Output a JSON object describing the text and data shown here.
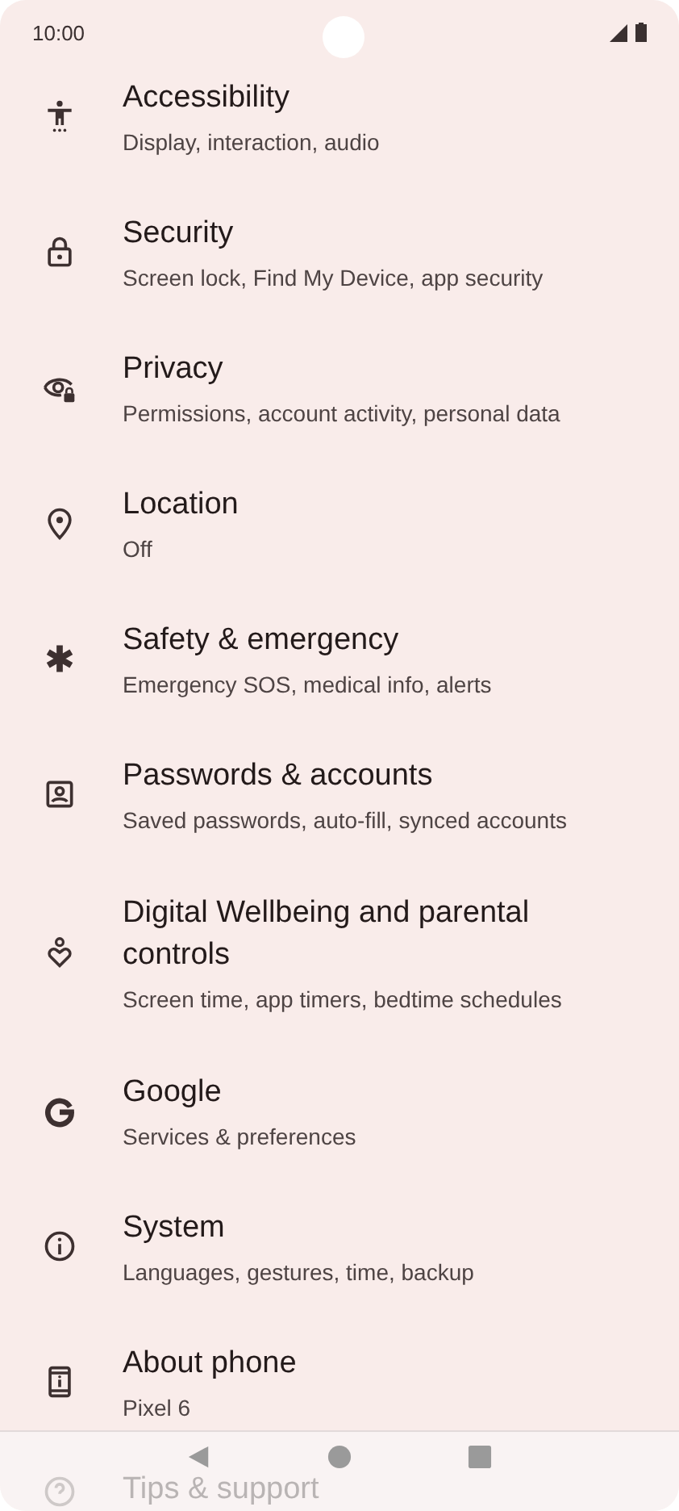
{
  "status_bar": {
    "time": "10:00"
  },
  "items": [
    {
      "title": "Accessibility",
      "subtitle": "Display, interaction, audio"
    },
    {
      "title": "Security",
      "subtitle": "Screen lock, Find My Device, app security"
    },
    {
      "title": "Privacy",
      "subtitle": "Permissions, account activity, personal data"
    },
    {
      "title": "Location",
      "subtitle": "Off"
    },
    {
      "title": "Safety & emergency",
      "subtitle": "Emergency SOS, medical info, alerts"
    },
    {
      "title": "Passwords & accounts",
      "subtitle": "Saved passwords, auto-fill, synced accounts"
    },
    {
      "title": "Digital Wellbeing and parental controls",
      "subtitle": "Screen time, app timers, bedtime schedules"
    },
    {
      "title": "Google",
      "subtitle": "Services & preferences"
    },
    {
      "title": "System",
      "subtitle": "Languages, gestures, time, backup"
    },
    {
      "title": "About phone",
      "subtitle": "Pixel 6"
    },
    {
      "title": "Tips & support"
    }
  ]
}
